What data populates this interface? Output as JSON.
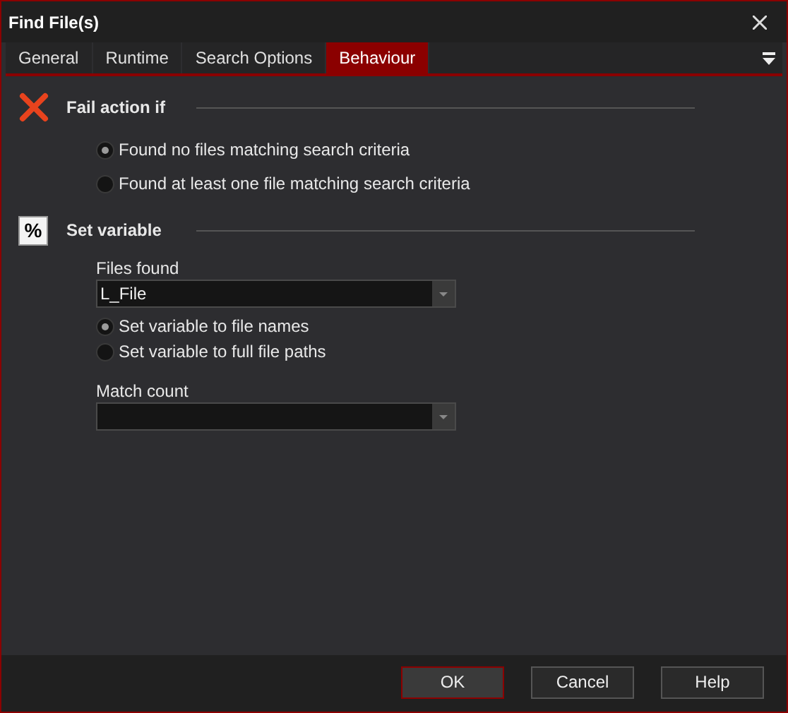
{
  "window": {
    "title": "Find File(s)"
  },
  "tabs": [
    {
      "label": "General",
      "selected": false
    },
    {
      "label": "Runtime",
      "selected": false
    },
    {
      "label": "Search Options",
      "selected": false
    },
    {
      "label": "Behaviour",
      "selected": true
    }
  ],
  "fail_section": {
    "title": "Fail action if",
    "options": [
      {
        "label": "Found no files matching search criteria",
        "selected": true
      },
      {
        "label": "Found at least one file matching search criteria",
        "selected": false
      }
    ]
  },
  "variable_section": {
    "icon": "%",
    "title": "Set variable",
    "files_found": {
      "label": "Files found",
      "value": "L_File"
    },
    "options": [
      {
        "label": "Set variable to file names",
        "selected": true
      },
      {
        "label": "Set variable to full file paths",
        "selected": false
      }
    ],
    "match_count": {
      "label": "Match count"
    }
  },
  "buttons": [
    {
      "label": "OK",
      "default": true
    },
    {
      "label": "Cancel",
      "default": false
    },
    {
      "label": "Help",
      "default": false
    }
  ]
}
